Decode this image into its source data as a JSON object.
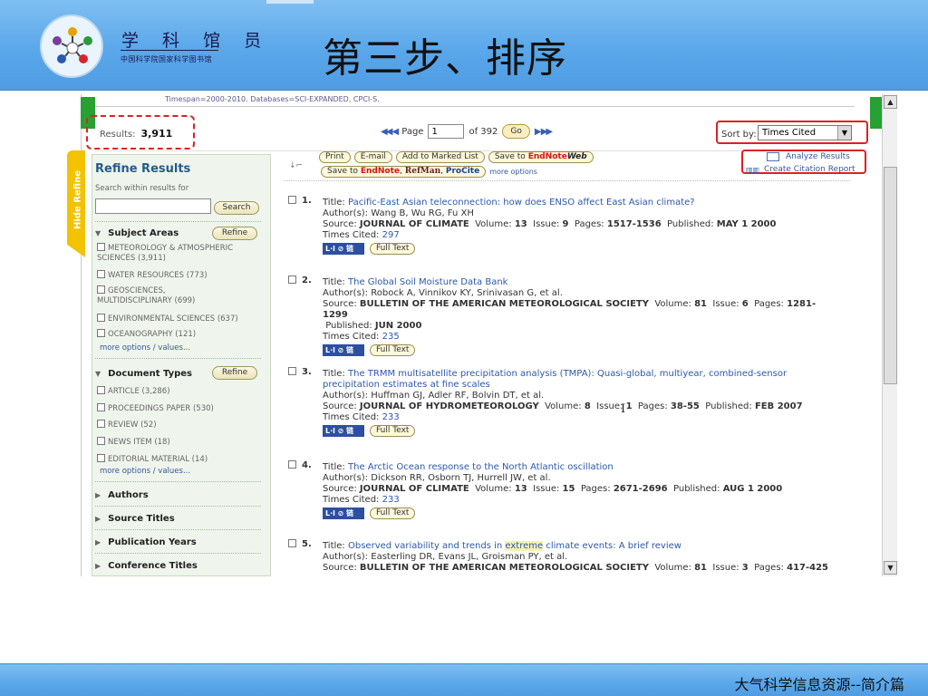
{
  "slide": {
    "org_name": "学 科 馆 员",
    "org_subtitle": "中国科学院国家科学图书馆",
    "title": "第三步、排序",
    "footer": "大气科学信息资源--简介篇"
  },
  "wos": {
    "timespan": "Timespan=2000-2010. Databases=SCI-EXPANDED, CPCI-S.",
    "results_label": "Results:",
    "results_count": "3,911",
    "pager": {
      "first_prev": "◀◀ ◀",
      "page_label": "Page",
      "page_value": "1",
      "of_label": "of 392",
      "go_label": "Go",
      "next_last": "▶ ▶▶"
    },
    "sort": {
      "label": "Sort by:",
      "value": "Times Cited"
    },
    "hide_refine": "Hide Refine",
    "refine": {
      "title": "Refine Results",
      "search_within": "Search within results for",
      "search_button": "Search",
      "subject_areas": {
        "heading": "Subject Areas",
        "refine_button": "Refine",
        "items": [
          "METEOROLOGY & ATMOSPHERIC SCIENCES (3,911)",
          "WATER RESOURCES (773)",
          "GEOSCIENCES, MULTIDISCIPLINARY (699)",
          "ENVIRONMENTAL SCIENCES (637)",
          "OCEANOGRAPHY (121)"
        ],
        "more": "more options / values..."
      },
      "document_types": {
        "heading": "Document Types",
        "refine_button": "Refine",
        "items": [
          "ARTICLE (3,286)",
          "PROCEEDINGS PAPER (530)",
          "REVIEW (52)",
          "NEWS ITEM (18)",
          "EDITORIAL MATERIAL (14)"
        ],
        "more": "more options / values..."
      },
      "collapsed": [
        "Authors",
        "Source Titles",
        "Publication Years",
        "Conference Titles"
      ]
    },
    "toolbar": {
      "print": "Print",
      "email": "E-mail",
      "marked_list": "Add to Marked List",
      "save_to_prefix": "Save to",
      "endnote": "EndNote",
      "endnote_web": "Web",
      "refman": "RefMan",
      "procite": "ProCite",
      "more_options": "more options",
      "analyze": "Analyze Results",
      "citation_report": "Create Citation Report"
    },
    "records": [
      {
        "num": "1.",
        "title": "Pacific-East Asian teleconnection: how does ENSO affect East Asian climate?",
        "authors": "Wang B, Wu RG, Fu XH",
        "source": "JOURNAL OF CLIMATE",
        "volume": "13",
        "issue": "9",
        "pages": "1517-1536",
        "published": "MAY 1 2000",
        "times_cited": "297"
      },
      {
        "num": "2.",
        "title": "The Global Soil Moisture Data Bank",
        "authors": "Robock A, Vinnikov KY, Srinivasan G, et al.",
        "source": "BULLETIN OF THE AMERICAN METEOROLOGICAL SOCIETY",
        "volume": "81",
        "issue": "6",
        "pages": "1281-1299",
        "published": "JUN 2000",
        "times_cited": "235"
      },
      {
        "num": "3.",
        "title": "The TRMM multisatellite precipitation analysis (TMPA): Quasi-global, multiyear, combined-sensor precipitation estimates at fine scales",
        "authors": "Huffman GJ, Adler RF, Bolvin DT, et al.",
        "source": "JOURNAL OF HYDROMETEOROLOGY",
        "volume": "8",
        "issue": "1",
        "pages": "38-55",
        "published": "FEB 2007",
        "times_cited": "233"
      },
      {
        "num": "4.",
        "title": "The Arctic Ocean response to the North Atlantic oscillation",
        "authors": "Dickson RR, Osborn TJ, Hurrell JW, et al.",
        "source": "JOURNAL OF CLIMATE",
        "volume": "13",
        "issue": "15",
        "pages": "2671-2696",
        "published": "AUG 1 2000",
        "times_cited": "233"
      },
      {
        "num": "5.",
        "title_pre": "Observed variability and trends in ",
        "title_hl": "extreme",
        "title_post": " climate events: A brief review",
        "authors": "Easterling DR, Evans JL, Groisman PY, et al.",
        "source": "BULLETIN OF THE AMERICAN METEOROLOGICAL SOCIETY",
        "volume": "81",
        "issue": "3",
        "pages": "417-425"
      }
    ],
    "labels": {
      "title": "Title:",
      "authors": "Author(s):",
      "source": "Source:",
      "volume": "Volume:",
      "issue": "Issue:",
      "pages": "Pages:",
      "published": "Published:",
      "times_cited": "Times Cited:",
      "full_text": "Full Text",
      "link_badge": "L·l ⊘ 链"
    }
  }
}
